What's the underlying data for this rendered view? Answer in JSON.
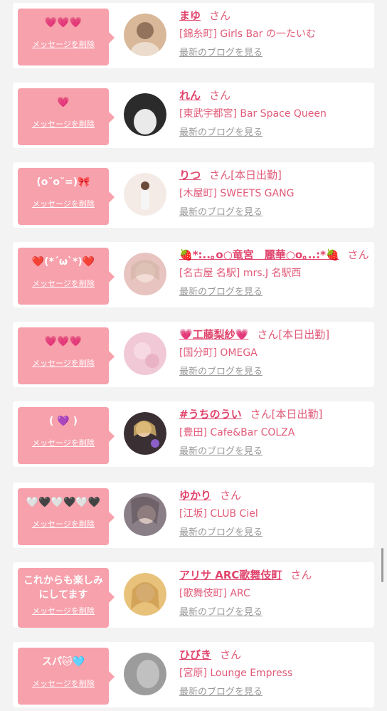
{
  "items": [
    {
      "message": "💗💗💗",
      "delete_label": "メッセージを削除",
      "name": "まゆ",
      "honorific": "さん",
      "status": "",
      "shop": "[錦糸町] Girls Bar の一たいむ",
      "blog_link": "最新のブログを見る",
      "avatar_color": "#d9b89a"
    },
    {
      "message": "💗",
      "delete_label": "メッセージを削除",
      "name": "れん",
      "honorific": "さん",
      "status": "",
      "shop": "[東武宇都宮] Bar Space Queen",
      "blog_link": "最新のブログを見る",
      "avatar_color": "#2b2b2b"
    },
    {
      "message": "(o˘o˘=)🎀",
      "delete_label": "メッセージを削除",
      "name": "りつ",
      "honorific": "さん",
      "status": "[本日出勤]",
      "shop": "[木屋町] SWEETS GANG",
      "blog_link": "最新のブログを見る",
      "avatar_color": "#f4ebe6"
    },
    {
      "message": "❤️(*´ω`*)❤️",
      "delete_label": "メッセージを削除",
      "name": "🍓*:..｡o○竜宮　麗華○o｡..:*🍓",
      "honorific": "さん",
      "status": "",
      "shop": "[名古屋 名駅] mrs.J 名駅西",
      "blog_link": "最新のブログを見る",
      "avatar_color": "#e7c4bf"
    },
    {
      "message": "💗💗💗",
      "delete_label": "メッセージを削除",
      "name": "💗工藤梨紗💗",
      "honorific": "さん",
      "status": "[本日出勤]",
      "shop": "[国分町] OMEGA",
      "blog_link": "最新のブログを見る",
      "avatar_color": "#f0c8d6"
    },
    {
      "message": "( 💜 )",
      "delete_label": "メッセージを削除",
      "name": "#うちのうい",
      "honorific": "さん",
      "status": "[本日出勤]",
      "shop": "[豊田] Cafe&Bar COLZA",
      "blog_link": "最新のブログを見る",
      "avatar_color": "#3a2f33"
    },
    {
      "message": "🤍🖤🤍🖤🤍🖤",
      "delete_label": "メッセージを削除",
      "name": "ゆかり",
      "honorific": "さん",
      "status": "",
      "shop": "[江坂] CLUB Ciel",
      "blog_link": "最新のブログを見る",
      "avatar_color": "#8a7f86"
    },
    {
      "message": "これからも楽しみ\nにしてます",
      "delete_label": "メッセージを削除",
      "name": "アリサ ARC歌舞伎町",
      "honorific": "さん",
      "status": "",
      "shop": "[歌舞伎町] ARC",
      "blog_link": "最新のブログを見る",
      "avatar_color": "#e8c27a"
    },
    {
      "message": "スパ🐱🩵",
      "delete_label": "メッセージを削除",
      "name": "ひびき",
      "honorific": "さん",
      "status": "",
      "shop": "[宮原] Lounge Empress",
      "blog_link": "最新のブログを見る",
      "avatar_color": "#9c9c9c"
    }
  ]
}
